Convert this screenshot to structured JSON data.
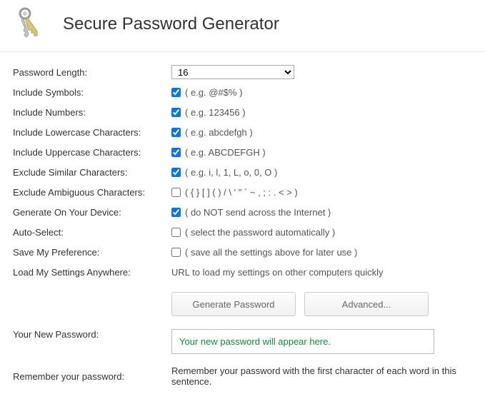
{
  "header": {
    "title": "Secure Password Generator",
    "icon": "keys-icon"
  },
  "rows": {
    "length": {
      "label": "Password Length:",
      "value": "16"
    },
    "symbols": {
      "label": "Include Symbols:",
      "checked": true,
      "hint": "( e.g. @#$% )"
    },
    "numbers": {
      "label": "Include Numbers:",
      "checked": true,
      "hint": "( e.g. 123456 )"
    },
    "lowercase": {
      "label": "Include Lowercase Characters:",
      "checked": true,
      "hint": "( e.g. abcdefgh )"
    },
    "uppercase": {
      "label": "Include Uppercase Characters:",
      "checked": true,
      "hint": "( e.g. ABCDEFGH )"
    },
    "similar": {
      "label": "Exclude Similar Characters:",
      "checked": true,
      "hint": "( e.g. i, l, 1, L, o, 0, O )"
    },
    "ambiguous": {
      "label": "Exclude Ambiguous Characters:",
      "checked": false,
      "hint": "( { } [ ] ( ) / \\ ' \" ` ~ , ; : . < > )"
    },
    "device": {
      "label": "Generate On Your Device:",
      "checked": true,
      "hint": "( do NOT send across the Internet )"
    },
    "autoselect": {
      "label": "Auto-Select:",
      "checked": false,
      "hint": "( select the password automatically )"
    },
    "savepref": {
      "label": "Save My Preference:",
      "checked": false,
      "hint": "( save all the settings above for later use )"
    },
    "loadsettings": {
      "label": "Load My Settings Anywhere:",
      "hint": "URL to load my settings on other computers quickly"
    }
  },
  "buttons": {
    "generate": "Generate Password",
    "advanced": "Advanced..."
  },
  "result": {
    "label": "Your New Password:",
    "placeholder": "Your new password will appear here."
  },
  "remember": {
    "label": "Remember your password:",
    "text": "Remember your password with the first character of each word in this sentence."
  }
}
